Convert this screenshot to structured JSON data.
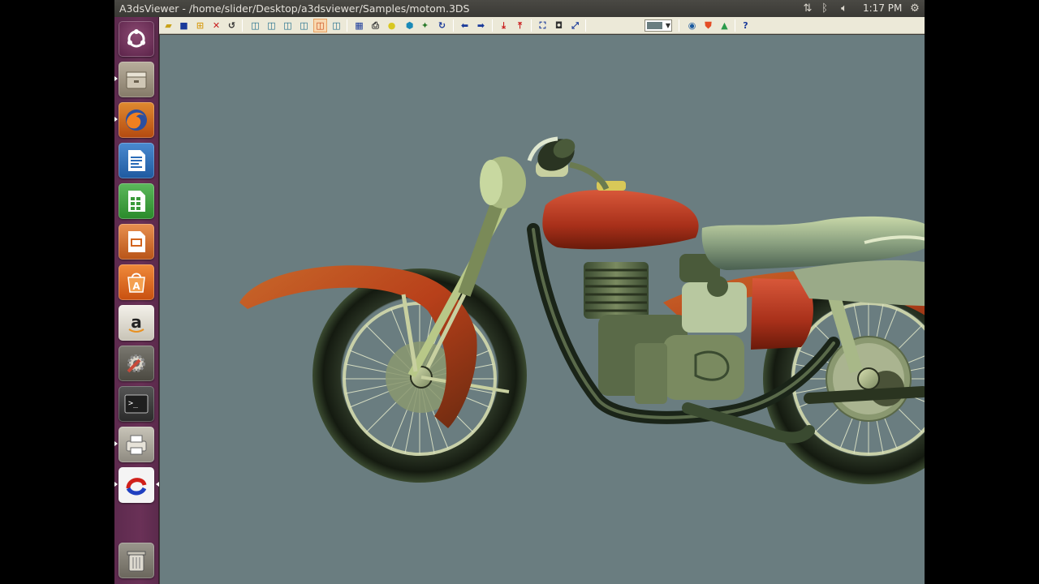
{
  "window": {
    "title": "A3dsViewer - /home/slider/Desktop/a3dsviewer/Samples/motom.3DS"
  },
  "top_panel": {
    "indicators": [
      "network-icon",
      "bluetooth-icon",
      "volume-icon",
      "settings-gear-icon"
    ],
    "clock": "1:17 PM"
  },
  "launcher": {
    "items": [
      {
        "name": "dash-home-icon",
        "color": "#e05a28"
      },
      {
        "name": "files-icon",
        "color": "#8a7f6f"
      },
      {
        "name": "firefox-icon",
        "color": "#e66000"
      },
      {
        "name": "writer-icon",
        "color": "#2a6bb8"
      },
      {
        "name": "calc-icon",
        "color": "#3a9a3a"
      },
      {
        "name": "impress-icon",
        "color": "#d2641e"
      },
      {
        "name": "software-center-icon",
        "color": "#e46a18"
      },
      {
        "name": "amazon-icon",
        "color": "#ddd8cc"
      },
      {
        "name": "system-settings-icon",
        "color": "#c84a3a"
      },
      {
        "name": "terminal-icon",
        "color": "#2b2b2b"
      },
      {
        "name": "printer-icon",
        "color": "#b8b4a8"
      },
      {
        "name": "a3dsviewer-icon",
        "color": "#e8e8e8"
      },
      {
        "name": "trash-icon",
        "color": "#8e8a80"
      }
    ]
  },
  "toolbar": {
    "buttons": [
      "open-icon",
      "save-icon",
      "grid-icon",
      "close-icon",
      "undo-icon",
      "view-front-icon",
      "view-back-icon",
      "view-left-icon",
      "view-right-icon",
      "view-top-icon",
      "view-bottom-icon",
      "wireframe-icon",
      "print-icon",
      "light-icon",
      "cube-icon",
      "orbit-icon",
      "rotate-left-icon",
      "rotate-right-icon",
      "export-down-icon",
      "export-up-icon",
      "fit-view-icon",
      "snapshot-icon",
      "fullscreen-icon",
      "web-icon",
      "html5-icon",
      "drive-icon",
      "help-icon"
    ],
    "background_color": "#697d80"
  },
  "viewport": {
    "background": "#6a7d80",
    "model_colors": {
      "body": "#8aa08a",
      "tank": "#b43a1a",
      "tire": "#1b2218",
      "spokes": "#dfe6c8"
    }
  }
}
